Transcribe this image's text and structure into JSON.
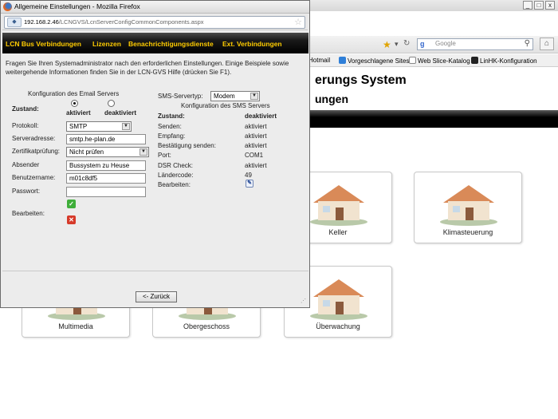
{
  "background": {
    "window_buttons": [
      "_",
      "□",
      "x"
    ],
    "search_placeholder": "Google",
    "bookmarks": [
      "Hotmail",
      "Vorgeschlagene Sites",
      "Web Slice-Katalog",
      "LinHK-Konfiguration"
    ],
    "page_title": "erungs System",
    "page_subtitle": "ungen",
    "tiles": [
      "Keller",
      "Klimasteuerung",
      "Multimedia",
      "Obergeschoss",
      "Überwachung"
    ]
  },
  "popup": {
    "title": "Allgemeine Einstellungen - Mozilla Firefox",
    "url_host": "192.168.2.46",
    "url_path": "/LCNGVS/LcnServerConfigCommonComponents.aspx",
    "menu": [
      "LCN Bus Verbindungen",
      "Lizenzen",
      "Benachrichtigungsdienste",
      "Ext. Verbindungen"
    ],
    "intro": "Fragen Sie Ihren Systemadministrator nach den erforderlichen Einstellungen. Einige Beispiele sowie weitergehende Informationen finden Sie in der LCN-GVS Hilfe (drücken Sie F1).",
    "email": {
      "heading": "Konfiguration des Email Servers",
      "state_label": "Zustand:",
      "state_on": "aktiviert",
      "state_off": "deaktiviert",
      "state_selected": "aktiviert",
      "protocol_label": "Protokoll:",
      "protocol_value": "SMTP",
      "server_label": "Serveradresse:",
      "server_value": "smtp.he-plan.de",
      "cert_label": "Zertifikatprüfung:",
      "cert_value": "Nicht prüfen",
      "sender_label": "Absender",
      "sender_value": "Bussystem zu Heuse",
      "user_label": "Benutzername:",
      "user_value": "m01c8df5",
      "password_label": "Passwort:",
      "password_value": "",
      "edit_label": "Bearbeiten:"
    },
    "sms": {
      "type_label": "SMS-Servertyp:",
      "type_value": "Modem",
      "heading": "Konfiguration des SMS Servers",
      "rows": [
        {
          "label": "Zustand:",
          "value": "deaktiviert"
        },
        {
          "label": "Senden:",
          "value": "aktiviert"
        },
        {
          "label": "Empfang:",
          "value": "aktiviert"
        },
        {
          "label": "Bestätigung senden:",
          "value": "aktiviert"
        },
        {
          "label": "Port:",
          "value": "COM1"
        },
        {
          "label": "DSR Check:",
          "value": "aktiviert"
        },
        {
          "label": "Ländercode:",
          "value": "49"
        },
        {
          "label": "Bearbeiten:",
          "value": ""
        }
      ]
    },
    "back_label": "<- Zurück"
  }
}
